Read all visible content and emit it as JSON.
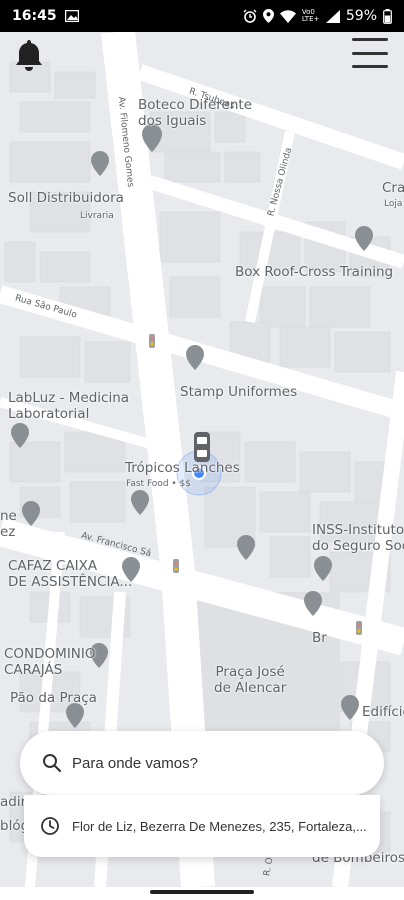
{
  "status_bar": {
    "time": "16:45",
    "battery": "59%",
    "network": "Vo0 LTE+"
  },
  "map": {
    "labels": {
      "boteco_line1": "Boteco Diferente",
      "boteco_line2": "dos Iguais",
      "soll": "Soll Distribuidora",
      "soll_sub": "Livraria",
      "box_roof": "Box Roof-Cross Training",
      "stamp": "Stamp Uniformes",
      "labluz_line1": "LabLuz - Medicina",
      "labluz_line2": "Laboratorial",
      "tropicos": "Trópicos Lanches",
      "tropicos_sub": "Fast Food • $$",
      "inss_line1": "INSS-Instituto Na",
      "inss_line2": "do Seguro Social",
      "cafaz_line1": "CAFAZ CAIXA",
      "cafaz_line2": "DE ASSISTÊNCIA...",
      "condominio_line1": "CONDOMINIO",
      "condominio_line2": "CARAJÁS",
      "pao": "Pão da Praça",
      "praca_line1": "Praça José",
      "praca_line2": "de Alencar",
      "edificio": "Edifício",
      "br": "Br",
      "cra": "Cra",
      "loja": "Loja",
      "bombeiros": "de Bombeiros Mi",
      "bloq": "blóg",
      "adir": "adir",
      "ne": "ne",
      "ez": "ez"
    },
    "streets": {
      "tsuzuki": "R. Tsuboas",
      "filomeno": "Av. Filomeno Gomes",
      "nossa": "R. Nossa Olinda",
      "sao_paulo": "Rua São Paulo",
      "francisco": "Av. Francisco Sá",
      "ot": "R. Ot"
    }
  },
  "search": {
    "placeholder": "Para onde vamos?",
    "recent_address": "Flor de Liz, Bezerra De Menezes, 235, Fortaleza,..."
  },
  "icons": {
    "bell": "bell-icon",
    "menu": "hamburger-menu-icon",
    "search": "search-icon",
    "history": "clock-history-icon",
    "car": "car-icon",
    "location": "current-location-dot-icon"
  }
}
